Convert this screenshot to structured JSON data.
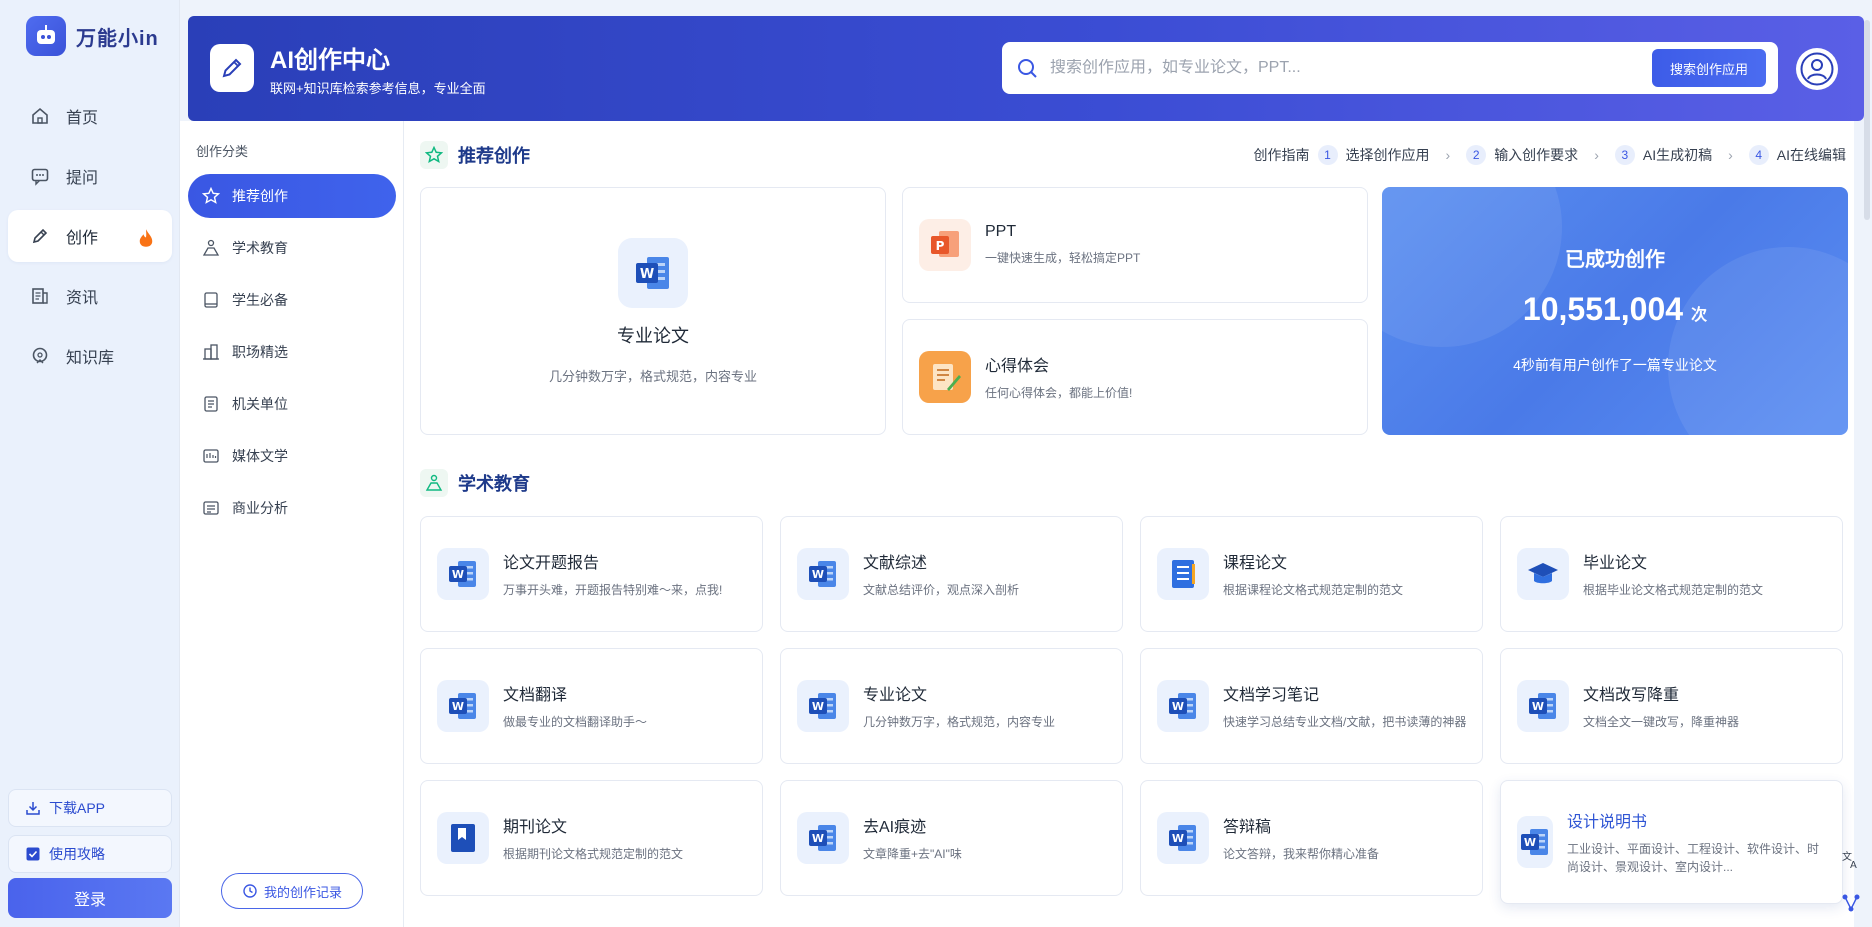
{
  "app": {
    "name": "万能小in"
  },
  "nav": [
    {
      "label": "首页",
      "icon": "home-icon"
    },
    {
      "label": "提问",
      "icon": "chat-icon"
    },
    {
      "label": "创作",
      "icon": "pen-icon",
      "active": true
    },
    {
      "label": "资讯",
      "icon": "news-icon"
    },
    {
      "label": "知识库",
      "icon": "knowledge-icon"
    }
  ],
  "sidebar_bottom": {
    "download": "下载APP",
    "guide": "使用攻略",
    "login": "登录"
  },
  "banner": {
    "title": "AI创作中心",
    "subtitle": "联网+知识库检索参考信息，专业全面",
    "search_placeholder": "搜索创作应用，如专业论文，PPT...",
    "search_button": "搜索创作应用"
  },
  "categories": {
    "title": "创作分类",
    "items": [
      "推荐创作",
      "学术教育",
      "学生必备",
      "职场精选",
      "机关单位",
      "媒体文学",
      "商业分析"
    ],
    "history_button": "我的创作记录"
  },
  "recommend": {
    "title": "推荐创作",
    "guide_label": "创作指南",
    "steps": [
      {
        "num": "1",
        "label": "选择创作应用"
      },
      {
        "num": "2",
        "label": "输入创作要求"
      },
      {
        "num": "3",
        "label": "AI生成初稿"
      },
      {
        "num": "4",
        "label": "AI在线编辑"
      }
    ],
    "main_card": {
      "title": "专业论文",
      "desc": "几分钟数万字，格式规范，内容专业"
    },
    "ppt": {
      "title": "PPT",
      "desc": "一键快速生成，轻松搞定PPT"
    },
    "xinde": {
      "title": "心得体会",
      "desc": "任何心得体会，都能上价值!"
    },
    "stats": {
      "label": "已成功创作",
      "count": "10,551,004",
      "unit": "次",
      "note": "4秒前有用户创作了一篇专业论文"
    }
  },
  "academic": {
    "title": "学术教育",
    "cards": [
      {
        "title": "论文开题报告",
        "desc": "万事开头难，开题报告特别难～来，点我!",
        "icon": "word-icon"
      },
      {
        "title": "文献综述",
        "desc": "文献总结评价，观点深入剖析",
        "icon": "word-icon"
      },
      {
        "title": "课程论文",
        "desc": "根据课程论文格式规范定制的范文",
        "icon": "list-icon"
      },
      {
        "title": "毕业论文",
        "desc": "根据毕业论文格式规范定制的范文",
        "icon": "graduation-cap-icon"
      },
      {
        "title": "文档翻译",
        "desc": "做最专业的文档翻译助手～",
        "icon": "word-icon"
      },
      {
        "title": "专业论文",
        "desc": "几分钟数万字，格式规范，内容专业",
        "icon": "word-icon"
      },
      {
        "title": "文档学习笔记",
        "desc": "快速学习总结专业文档/文献，把书读薄的神器",
        "icon": "word-icon"
      },
      {
        "title": "文档改写降重",
        "desc": "文档全文一键改写，降重神器",
        "icon": "word-icon"
      },
      {
        "title": "期刊论文",
        "desc": "根据期刊论文格式规范定制的范文",
        "icon": "bookmark-icon"
      },
      {
        "title": "去AI痕迹",
        "desc": "文章降重+去\"AI\"味",
        "icon": "word-icon"
      },
      {
        "title": "答辩稿",
        "desc": "论文答辩，我来帮你精心准备",
        "icon": "word-icon"
      },
      {
        "title": "设计说明书",
        "desc": "工业设计、平面设计、工程设计、软件设计、时尚设计、景观设计、室内设计...",
        "icon": "word-icon",
        "highlight": true
      }
    ]
  },
  "colors": {
    "brand": "#3a57e3",
    "banner_start": "#2a3fb8",
    "banner_end": "#5a5fe6",
    "stats_bg": "#5a8ff0"
  }
}
